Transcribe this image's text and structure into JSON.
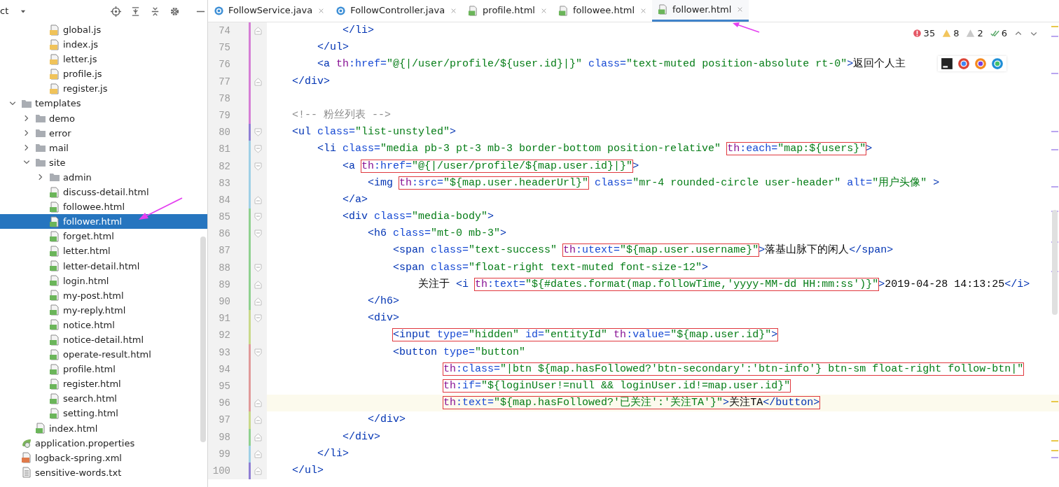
{
  "project_panel": {
    "title": "ct"
  },
  "project_tree": {
    "cut_branch": [
      {
        "label": "global.js",
        "kind": "js",
        "selected": false
      },
      {
        "label": "index.js",
        "kind": "js",
        "selected": false
      },
      {
        "label": "letter.js",
        "kind": "js",
        "selected": false
      },
      {
        "label": "profile.js",
        "kind": "js",
        "selected": false
      },
      {
        "label": "register.js",
        "kind": "js",
        "selected": false
      }
    ],
    "items": [
      {
        "label": "templates",
        "kind": "folder",
        "expanded": true,
        "selected": false,
        "children": [
          {
            "label": "demo",
            "kind": "folder",
            "expanded": false,
            "selected": false
          },
          {
            "label": "error",
            "kind": "folder",
            "expanded": false,
            "selected": false
          },
          {
            "label": "mail",
            "kind": "folder",
            "expanded": false,
            "selected": false
          },
          {
            "label": "site",
            "kind": "folder",
            "expanded": true,
            "selected": false,
            "children": [
              {
                "label": "admin",
                "kind": "folder",
                "expanded": false,
                "selected": false
              },
              {
                "label": "discuss-detail.html",
                "kind": "html",
                "selected": false
              },
              {
                "label": "followee.html",
                "kind": "html",
                "selected": false
              },
              {
                "label": "follower.html",
                "kind": "html",
                "selected": true
              },
              {
                "label": "forget.html",
                "kind": "html",
                "selected": false
              },
              {
                "label": "letter.html",
                "kind": "html",
                "selected": false
              },
              {
                "label": "letter-detail.html",
                "kind": "html",
                "selected": false
              },
              {
                "label": "login.html",
                "kind": "html",
                "selected": false
              },
              {
                "label": "my-post.html",
                "kind": "html",
                "selected": false
              },
              {
                "label": "my-reply.html",
                "kind": "html",
                "selected": false
              },
              {
                "label": "notice.html",
                "kind": "html",
                "selected": false
              },
              {
                "label": "notice-detail.html",
                "kind": "html",
                "selected": false
              },
              {
                "label": "operate-result.html",
                "kind": "html",
                "selected": false
              },
              {
                "label": "profile.html",
                "kind": "html",
                "selected": false
              },
              {
                "label": "register.html",
                "kind": "html",
                "selected": false
              },
              {
                "label": "search.html",
                "kind": "html",
                "selected": false
              },
              {
                "label": "setting.html",
                "kind": "html",
                "selected": false
              }
            ]
          },
          {
            "label": "index.html",
            "kind": "html",
            "selected": false
          }
        ]
      },
      {
        "label": "application.properties",
        "kind": "properties",
        "selected": false
      },
      {
        "label": "logback-spring.xml",
        "kind": "xml",
        "selected": false
      },
      {
        "label": "sensitive-words.txt",
        "kind": "txt",
        "selected": false
      }
    ]
  },
  "editor_tabs": [
    {
      "label": "FollowService.java",
      "kind": "java",
      "selected": false
    },
    {
      "label": "FollowController.java",
      "kind": "java",
      "selected": false
    },
    {
      "label": "profile.html",
      "kind": "html",
      "selected": false
    },
    {
      "label": "followee.html",
      "kind": "html",
      "selected": false
    },
    {
      "label": "follower.html",
      "kind": "html",
      "selected": true
    }
  ],
  "inspections": [
    {
      "kind": "error",
      "count": "35"
    },
    {
      "kind": "warning",
      "count": "8"
    },
    {
      "kind": "weak",
      "count": "2"
    },
    {
      "kind": "ok",
      "count": "6"
    }
  ],
  "code": {
    "lines": [
      {
        "number": "74",
        "color": "#d57fd5",
        "fold_close": true,
        "current": false,
        "tokens": [
          {
            "t": "            </li>",
            "kind": "tag"
          }
        ]
      },
      {
        "number": "75",
        "color": "#d57fd5",
        "current": false,
        "tokens": [
          {
            "t": "        </ul>",
            "kind": "tag"
          }
        ]
      },
      {
        "number": "76",
        "color": "#d57fd5",
        "current": false,
        "tokens": [
          {
            "t": "        <a ",
            "kind": "tag"
          },
          {
            "t": "th",
            "kind": "th"
          },
          {
            "t": ":href=",
            "kind": "attr"
          },
          {
            "t": "\"@{|/user/profile/${user.id}|}\"",
            "kind": "str"
          },
          {
            "t": " class=",
            "kind": "attr"
          },
          {
            "t": "\"text-muted position-absolute rt-0\"",
            "kind": "str"
          },
          {
            "t": ">",
            "kind": "tag"
          },
          {
            "t": "返回个人主",
            "kind": "text"
          }
        ]
      },
      {
        "number": "77",
        "color": "#d57fd5",
        "fold_close": true,
        "current": false,
        "tokens": [
          {
            "t": "    </div>",
            "kind": "tag"
          }
        ]
      },
      {
        "number": "78",
        "color": "#d57fd5",
        "current": false
      },
      {
        "number": "79",
        "color": "#d57fd5",
        "current": false,
        "tokens": [
          {
            "t": "    <!-- 粉丝列表 -->",
            "kind": "comment"
          }
        ]
      },
      {
        "number": "80",
        "color": "#8f7fd4",
        "fold_open": true,
        "current": false,
        "tokens": [
          {
            "t": "    <ul",
            "kind": "tag"
          },
          {
            "t": " class=",
            "kind": "attr"
          },
          {
            "t": "\"list-unstyled\"",
            "kind": "str"
          },
          {
            "t": ">",
            "kind": "tag"
          }
        ]
      },
      {
        "number": "81",
        "color": "#9fd0e6",
        "fold_open": true,
        "current": false,
        "tokens": [
          {
            "t": "        <li",
            "kind": "tag"
          },
          {
            "t": " class=",
            "kind": "attr"
          },
          {
            "t": "\"media pb-3 pt-3 mb-3 border-bottom position-relative\" ",
            "kind": "str"
          },
          {
            "kind": "box",
            "parts": [
              {
                "t": "th",
                "kind": "th"
              },
              {
                "t": ":each=",
                "kind": "attr"
              },
              {
                "t": "\"map:${users}\"",
                "kind": "str"
              }
            ]
          },
          {
            "t": ">",
            "kind": "tag"
          }
        ]
      },
      {
        "number": "82",
        "color": "#9fd0e6",
        "fold_open": true,
        "current": false,
        "tokens": [
          {
            "t": "            <a ",
            "kind": "tag"
          },
          {
            "kind": "box",
            "parts": [
              {
                "t": "th",
                "kind": "th"
              },
              {
                "t": ":href=",
                "kind": "attr"
              },
              {
                "t": "\"@{|/user/profile/${map.user.id}|}\"",
                "kind": "str"
              }
            ]
          },
          {
            "t": ">",
            "kind": "tag"
          }
        ]
      },
      {
        "number": "83",
        "color": "#9fd0e6",
        "current": false,
        "tokens": [
          {
            "t": "                <img ",
            "kind": "tag"
          },
          {
            "kind": "box",
            "parts": [
              {
                "t": "th",
                "kind": "th"
              },
              {
                "t": ":src=",
                "kind": "attr"
              },
              {
                "t": "\"${map.user.headerUrl}\"",
                "kind": "str"
              }
            ]
          },
          {
            "t": " class=",
            "kind": "attr"
          },
          {
            "t": "\"mr-4 rounded-circle user-header\"",
            "kind": "str"
          },
          {
            "t": " alt=",
            "kind": "attr"
          },
          {
            "t": "\"用户头像\"",
            "kind": "str"
          },
          {
            "t": " >",
            "kind": "tag"
          }
        ]
      },
      {
        "number": "84",
        "color": "#9fd0e6",
        "fold_close": true,
        "current": false,
        "tokens": [
          {
            "t": "            </a>",
            "kind": "tag"
          }
        ]
      },
      {
        "number": "85",
        "color": "#8fd18f",
        "fold_open": true,
        "current": false,
        "tokens": [
          {
            "t": "            <div",
            "kind": "tag"
          },
          {
            "t": " class=",
            "kind": "attr"
          },
          {
            "t": "\"media-body\"",
            "kind": "str"
          },
          {
            "t": ">",
            "kind": "tag"
          }
        ]
      },
      {
        "number": "86",
        "color": "#8fd18f",
        "fold_open": true,
        "current": false,
        "tokens": [
          {
            "t": "                <h6",
            "kind": "tag"
          },
          {
            "t": " class=",
            "kind": "attr"
          },
          {
            "t": "\"mt-0 mb-3\"",
            "kind": "str"
          },
          {
            "t": ">",
            "kind": "tag"
          }
        ]
      },
      {
        "number": "87",
        "color": "#8fd18f",
        "current": false,
        "tokens": [
          {
            "t": "                    <span",
            "kind": "tag"
          },
          {
            "t": " class=",
            "kind": "attr"
          },
          {
            "t": "\"text-success\" ",
            "kind": "str"
          },
          {
            "kind": "box",
            "parts": [
              {
                "t": "th",
                "kind": "th"
              },
              {
                "t": ":utext=",
                "kind": "attr"
              },
              {
                "t": "\"${map.user.username}\"",
                "kind": "str"
              }
            ]
          },
          {
            "t": ">",
            "kind": "tag"
          },
          {
            "t": "落基山脉下的闲人",
            "kind": "text"
          },
          {
            "t": "</span>",
            "kind": "tag"
          }
        ]
      },
      {
        "number": "88",
        "color": "#8fd18f",
        "fold_open": true,
        "current": false,
        "tokens": [
          {
            "t": "                    <span",
            "kind": "tag"
          },
          {
            "t": " class=",
            "kind": "attr"
          },
          {
            "t": "\"float-right text-muted font-size-12\"",
            "kind": "str"
          },
          {
            "t": ">",
            "kind": "tag"
          }
        ]
      },
      {
        "number": "89",
        "color": "#8fd18f",
        "fold_close": true,
        "current": false,
        "tokens": [
          {
            "t": "                        关注于 ",
            "kind": "text"
          },
          {
            "t": "<i ",
            "kind": "tag"
          },
          {
            "kind": "box",
            "parts": [
              {
                "t": "th",
                "kind": "th"
              },
              {
                "t": ":text=",
                "kind": "attr"
              },
              {
                "t": "\"${#dates.format(map.followTime,'yyyy-MM-dd HH:mm:ss')}\"",
                "kind": "str"
              }
            ]
          },
          {
            "t": ">",
            "kind": "tag"
          },
          {
            "t": "2019-04-28 14:13:25",
            "kind": "text"
          },
          {
            "t": "</i>",
            "kind": "tag"
          }
        ]
      },
      {
        "number": "90",
        "color": "#8fd18f",
        "fold_close": true,
        "current": false,
        "tokens": [
          {
            "t": "                </h6>",
            "kind": "tag"
          }
        ]
      },
      {
        "number": "91",
        "color": "#c9d98a",
        "fold_open": true,
        "current": false,
        "tokens": [
          {
            "t": "                <div>",
            "kind": "tag"
          }
        ]
      },
      {
        "number": "92",
        "color": "#c9d98a",
        "current": false,
        "tokens": [
          {
            "kind": "box",
            "parts": [
              {
                "t": "                    <input",
                "kind": "tag"
              },
              {
                "t": " type=",
                "kind": "attr"
              },
              {
                "t": "\"hidden\"",
                "kind": "str"
              },
              {
                "t": " id=",
                "kind": "attr"
              },
              {
                "t": "\"entityId\" ",
                "kind": "str"
              },
              {
                "t": "th",
                "kind": "th"
              },
              {
                "t": ":value=",
                "kind": "attr"
              },
              {
                "t": "\"${map.user.id}\"",
                "kind": "str"
              },
              {
                "t": ">",
                "kind": "tag"
              }
            ]
          }
        ]
      },
      {
        "number": "93",
        "color": "#e09a9a",
        "fold_open": true,
        "current": false,
        "tokens": [
          {
            "t": "                    <button",
            "kind": "tag"
          },
          {
            "t": " type=",
            "kind": "attr"
          },
          {
            "t": "\"button\"",
            "kind": "str"
          }
        ]
      },
      {
        "number": "94",
        "color": "#e09a9a",
        "current": false,
        "tokens": [
          {
            "kind": "box",
            "parts": [
              {
                "t": "                            th",
                "kind": "th"
              },
              {
                "t": ":class=",
                "kind": "attr"
              },
              {
                "t": "\"|btn ${map.hasFollowed?'btn-secondary':'btn-info'} btn-sm float-right follow-btn|\"",
                "kind": "str"
              }
            ]
          }
        ]
      },
      {
        "number": "95",
        "color": "#e09a9a",
        "current": false,
        "tokens": [
          {
            "kind": "box",
            "parts": [
              {
                "t": "                            th",
                "kind": "th"
              },
              {
                "t": ":if=",
                "kind": "attr"
              },
              {
                "t": "\"${loginUser!=null && loginUser.id!=map.user.id}\"",
                "kind": "str"
              }
            ]
          }
        ]
      },
      {
        "number": "96",
        "color": "#e09a9a",
        "fold_close": true,
        "current": true,
        "tokens": [
          {
            "kind": "box",
            "parts": [
              {
                "t": "                            th",
                "kind": "th"
              },
              {
                "t": ":text=",
                "kind": "attr"
              },
              {
                "t": "\"${map.hasFollowed?'已关注':'关注TA'}\"",
                "kind": "str"
              },
              {
                "t": ">",
                "kind": "tag"
              },
              {
                "t": "关注TA",
                "kind": "text"
              },
              {
                "t": "</button>",
                "kind": "tag"
              }
            ]
          }
        ]
      },
      {
        "number": "97",
        "color": "#c9d98a",
        "fold_close": true,
        "current": false,
        "tokens": [
          {
            "t": "                </div>",
            "kind": "tag"
          }
        ]
      },
      {
        "number": "98",
        "color": "#8fd18f",
        "fold_close": true,
        "current": false,
        "tokens": [
          {
            "t": "            </div>",
            "kind": "tag"
          }
        ]
      },
      {
        "number": "99",
        "color": "#9fd0e6",
        "fold_close": true,
        "current": false,
        "tokens": [
          {
            "t": "        </li>",
            "kind": "tag"
          }
        ]
      },
      {
        "number": "100",
        "color": "#8f7fd4",
        "fold_close": true,
        "current": false,
        "tokens": [
          {
            "t": "    </ul>",
            "kind": "tag"
          }
        ]
      }
    ]
  }
}
